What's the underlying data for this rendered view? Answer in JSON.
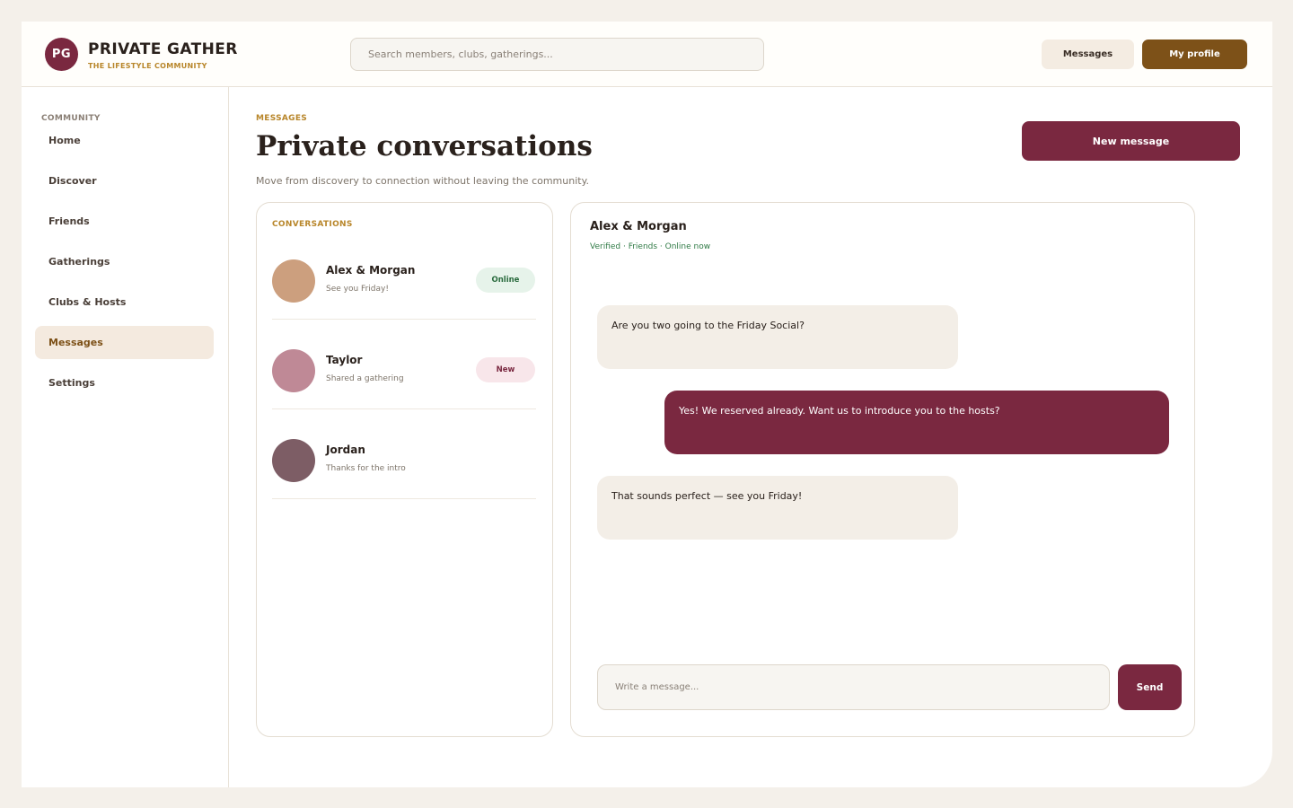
{
  "brand": {
    "initials": "PG",
    "name": "PRIVATE GATHER",
    "tagline": "THE LIFESTYLE COMMUNITY",
    "color": "#7a2840"
  },
  "header": {
    "search_placeholder": "Search members, clubs, gatherings...",
    "messages_label": "Messages",
    "profile_label": "My profile"
  },
  "sidebar": {
    "section": "COMMUNITY",
    "items": [
      {
        "label": "Home",
        "active": false
      },
      {
        "label": "Discover",
        "active": false
      },
      {
        "label": "Friends",
        "active": false
      },
      {
        "label": "Gatherings",
        "active": false
      },
      {
        "label": "Clubs & Hosts",
        "active": false
      },
      {
        "label": "Messages",
        "active": true
      },
      {
        "label": "Settings",
        "active": false
      }
    ]
  },
  "main": {
    "eyebrow": "MESSAGES",
    "title": "Private conversations",
    "subtitle": "Move from discovery to connection without leaving the community.",
    "new_message_label": "New message"
  },
  "conversations": {
    "heading": "CONVERSATIONS",
    "items": [
      {
        "name": "Alex & Morgan",
        "preview": "See you Friday!",
        "badge": "Online",
        "avatar_color": "#cc9f7e"
      },
      {
        "name": "Taylor",
        "preview": "Shared a gathering",
        "badge": "New",
        "avatar_color": "#bf8996"
      },
      {
        "name": "Jordan",
        "preview": "Thanks for the intro",
        "badge": "",
        "avatar_color": "#7d5d65"
      }
    ]
  },
  "thread": {
    "name": "Alex & Morgan",
    "status": "Verified · Friends · Online now",
    "messages": [
      {
        "direction": "in",
        "text": "Are you two going to the Friday Social?"
      },
      {
        "direction": "out",
        "text": "Yes! We reserved already. Want us to introduce you to the hosts?"
      },
      {
        "direction": "in",
        "text": "That sounds perfect — see you Friday!"
      }
    ],
    "compose_placeholder": "Write a message...",
    "send_label": "Send"
  }
}
